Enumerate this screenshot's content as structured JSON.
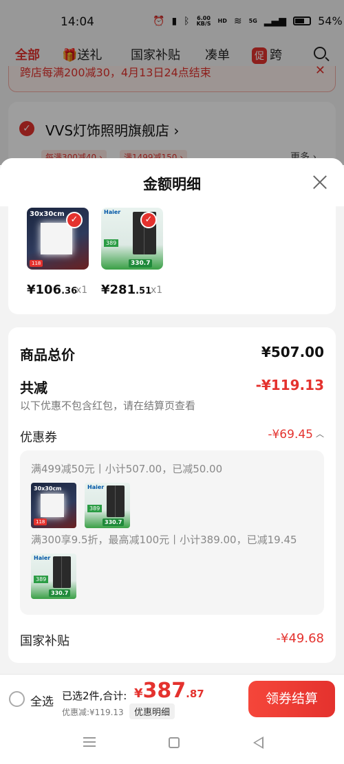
{
  "status_bar": {
    "time": "14:04",
    "network_speed_value": "6.00",
    "network_speed_unit": "KB/S",
    "hd_label": "HD",
    "signal_label": "5G",
    "battery": "54%"
  },
  "top_nav": {
    "tabs": [
      "全部",
      "送礼",
      "国家补贴",
      "凑单",
      "跨"
    ],
    "promo_badge": "促",
    "active_tab": "全部"
  },
  "notice": {
    "text": "跨店每满200减30，4月13日24点结束",
    "close": "✕"
  },
  "store": {
    "name": "VVS灯饰照明旗舰店",
    "arrow": "›",
    "tags": [
      "每满300减40 ›",
      "满1499减150 ›"
    ],
    "more": "更多 ›"
  },
  "sheet": {
    "title": "金额明细",
    "items": [
      {
        "thumb_text": "30x30cm",
        "thumb_price": "118",
        "price_int": "¥106",
        "price_dec": ".36",
        "qty": "x1"
      },
      {
        "brand": "Haier",
        "thumb_badge": "389",
        "thumb_price": "330.7",
        "price_int": "¥281",
        "price_dec": ".51",
        "qty": "x1"
      }
    ],
    "total_label": "商品总价",
    "total_value": "¥507.00",
    "reduce_label": "共减",
    "reduce_value": "-¥119.13",
    "reduce_note": "以下优惠不包含红包，请在结算页查看",
    "coupon_label": "优惠券",
    "coupon_value": "-¥69.45",
    "coupon_rules": [
      "满499减50元丨小计507.00，已减50.00",
      "满300享9.5折，最高减100元丨小计389.00，已减19.45"
    ],
    "subsidy_label": "国家补贴",
    "subsidy_value": "-¥49.68"
  },
  "bottom_bar": {
    "select_all": "全选",
    "summary": "已选2件,合计:",
    "total_yen": "¥",
    "total_int": "387",
    "total_dec": ".87",
    "discount": "优惠减:¥119.13",
    "detail_chip": "优惠明细",
    "checkout": "领券结算"
  },
  "colors": {
    "accent_red": "#e4322e",
    "text_dark": "#111111",
    "muted": "#888888"
  },
  "icons": [
    "alarm-icon",
    "vibrate-icon",
    "bluetooth-icon",
    "wifi-icon",
    "signal-icon",
    "battery-icon",
    "gift-icon",
    "search-icon",
    "close-icon",
    "checkmark-icon",
    "chevron-up-icon",
    "menu-icon",
    "home-icon",
    "back-icon"
  ]
}
